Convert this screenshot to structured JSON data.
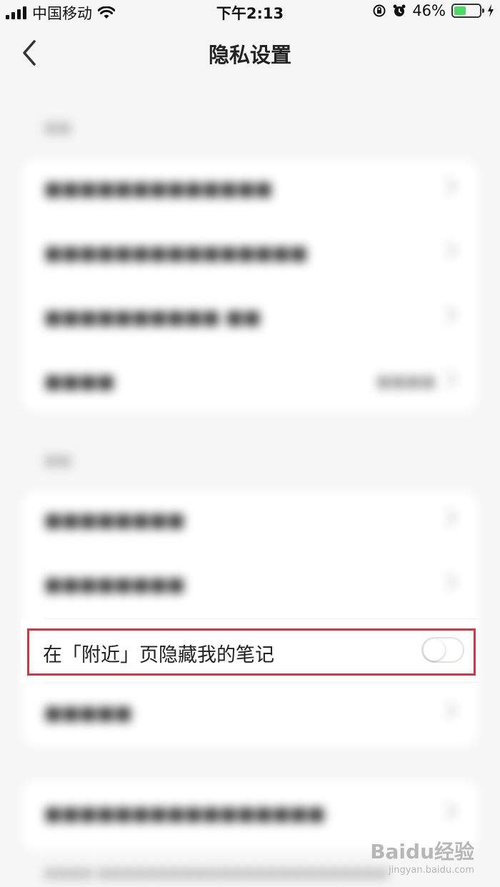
{
  "status_bar": {
    "carrier": "中国移动",
    "time": "下午2:13",
    "battery_text": "46%",
    "battery_level": 0.46,
    "battery_color": "#4cd964"
  },
  "nav": {
    "title": "隐私设置",
    "back_icon": "chevron-left-icon"
  },
  "focus_item": {
    "label": "在「附近」页隐藏我的笔记",
    "toggle_on": false
  },
  "highlight_color": "#d9333f",
  "watermark": {
    "main": "Baidu经验",
    "sub": "jingyan.baidu.com"
  }
}
